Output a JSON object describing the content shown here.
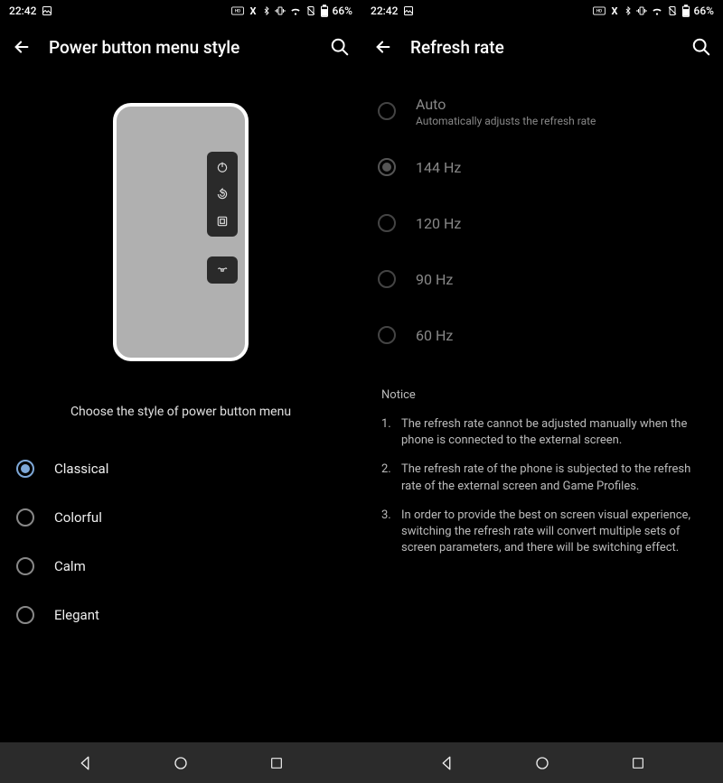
{
  "status": {
    "time": "22:42",
    "battery": "66%"
  },
  "left": {
    "title": "Power button menu style",
    "subtitle": "Choose the style of power button menu",
    "options": [
      {
        "label": "Classical"
      },
      {
        "label": "Colorful"
      },
      {
        "label": "Calm"
      },
      {
        "label": "Elegant"
      }
    ],
    "selected_index": 0
  },
  "right": {
    "title": "Refresh rate",
    "options": [
      {
        "label": "Auto",
        "sub": "Automatically adjusts the refresh rate"
      },
      {
        "label": "144 Hz"
      },
      {
        "label": "120 Hz"
      },
      {
        "label": "90 Hz"
      },
      {
        "label": "60 Hz"
      }
    ],
    "selected_index": 1,
    "disabled": true,
    "notice_title": "Notice",
    "notice": [
      "The refresh rate cannot be adjusted manually when the phone is connected to the external screen.",
      "The refresh rate of the phone is subjected to the refresh rate of the external screen and Game Profiles.",
      "In order to provide the best on screen visual experience, switching the refresh rate will convert multiple sets of screen parameters, and there will be switching effect."
    ]
  }
}
